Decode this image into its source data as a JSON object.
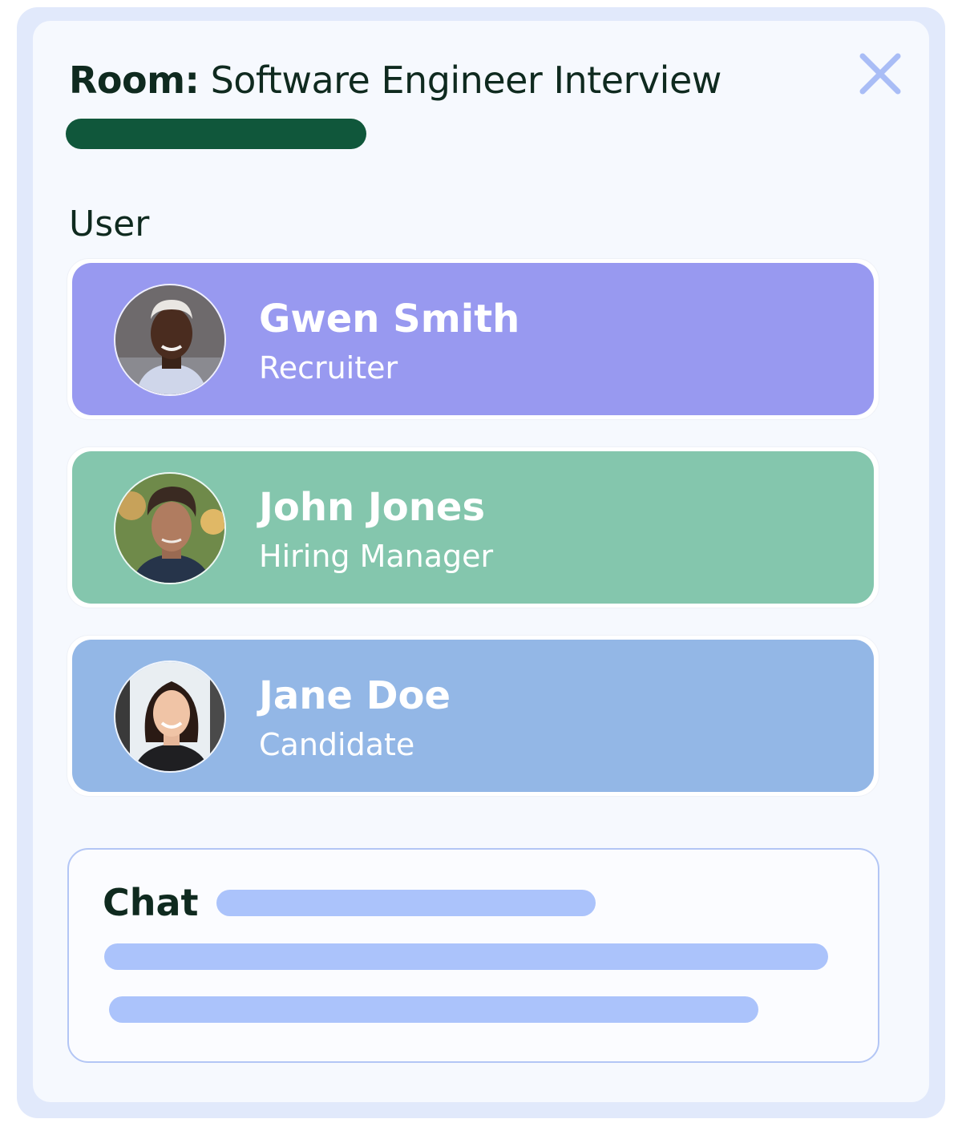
{
  "room": {
    "label": "Room:",
    "name": "Software Engineer Interview",
    "progress_color": "#10573b"
  },
  "close_icon": "close-icon",
  "users_section": {
    "label": "User",
    "users": [
      {
        "name": "Gwen Smith",
        "role": "Recruiter",
        "color": "#9899f0",
        "avatar": "avatar-gwen"
      },
      {
        "name": "John Jones",
        "role": "Hiring Manager",
        "color": "#84c6ad",
        "avatar": "avatar-john"
      },
      {
        "name": "Jane Doe",
        "role": "Candidate",
        "color": "#93b7e6",
        "avatar": "avatar-jane"
      }
    ]
  },
  "chat": {
    "label": "Chat",
    "placeholder_line_color": "#abc3fb"
  }
}
